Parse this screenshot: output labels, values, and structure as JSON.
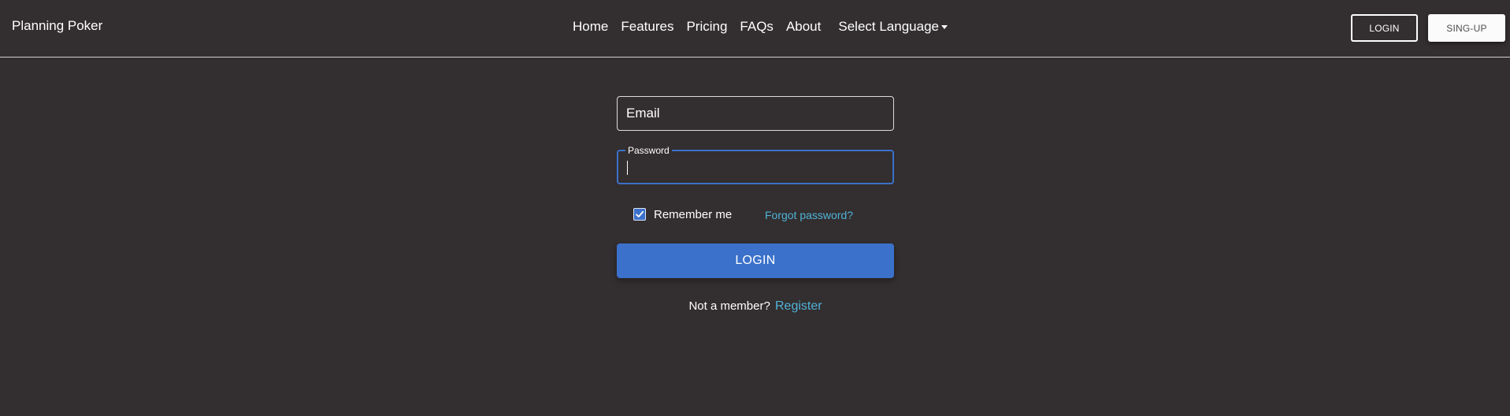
{
  "brand": "Planning Poker",
  "nav": {
    "links": [
      "Home",
      "Features",
      "Pricing",
      "FAQs",
      "About"
    ],
    "language_label": "Select Language",
    "language_icon": "caret-down-icon"
  },
  "header_buttons": {
    "login": "LOGIN",
    "signup": "SING-UP"
  },
  "form": {
    "email_placeholder": "Email",
    "email_value": "",
    "password_label": "Password",
    "password_value": "",
    "remember_label": "Remember me",
    "remember_checked": true,
    "forgot_link": "Forgot password?",
    "login_button": "LOGIN",
    "not_member_text": "Not a member?",
    "register_link": "Register"
  },
  "colors": {
    "background": "#332e2f",
    "primary": "#3b71ca",
    "link": "#4fb3d9"
  }
}
